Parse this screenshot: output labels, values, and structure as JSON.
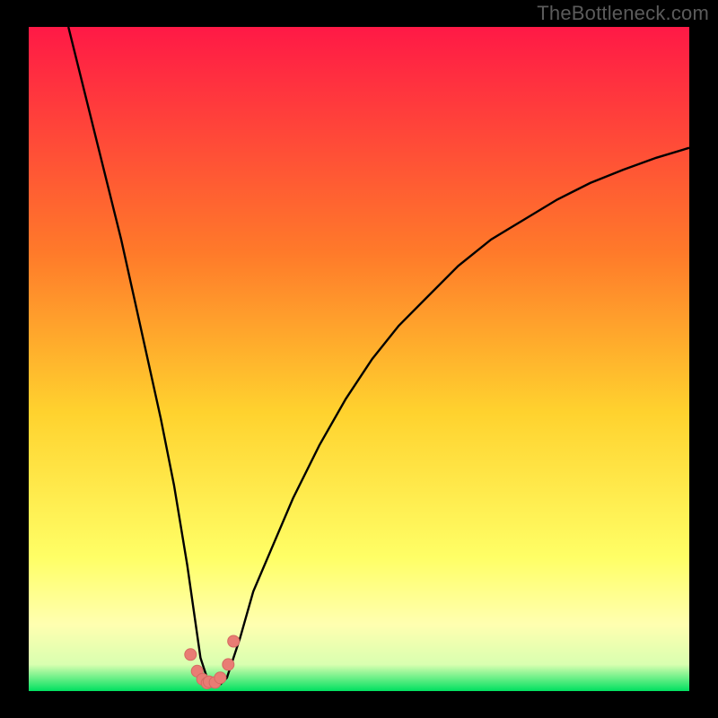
{
  "watermark": "TheBottleneck.com",
  "colors": {
    "background": "#000000",
    "gradient_top": "#ff1946",
    "gradient_mid_upper": "#ff7a2a",
    "gradient_mid": "#ffd22e",
    "gradient_lower": "#ffff66",
    "gradient_pale": "#ffffb0",
    "gradient_bottom": "#00e060",
    "curve": "#000000",
    "marker_fill": "#e97c74",
    "marker_stroke": "#d46a62"
  },
  "chart_data": {
    "type": "line",
    "title": "",
    "xlabel": "",
    "ylabel": "",
    "xlim": [
      0,
      100
    ],
    "ylim": [
      0,
      100
    ],
    "series": [
      {
        "name": "bottleneck-curve",
        "x": [
          6,
          8,
          10,
          12,
          14,
          16,
          18,
          20,
          22,
          24,
          25,
          26,
          27,
          28,
          29,
          30,
          32,
          34,
          37,
          40,
          44,
          48,
          52,
          56,
          60,
          65,
          70,
          75,
          80,
          85,
          90,
          95,
          100
        ],
        "y": [
          100,
          92,
          84,
          76,
          68,
          59,
          50,
          41,
          31,
          19,
          12,
          5,
          2,
          1,
          1,
          2,
          8,
          15,
          22,
          29,
          37,
          44,
          50,
          55,
          59,
          64,
          68,
          71,
          74,
          76.5,
          78.5,
          80.3,
          81.8
        ]
      }
    ],
    "markers": {
      "name": "highlight-points",
      "x": [
        24.5,
        25.5,
        26.3,
        27.0,
        27.3,
        28.2,
        29.0,
        30.2,
        31.0
      ],
      "y": [
        5.5,
        3.0,
        1.8,
        1.2,
        1.4,
        1.3,
        2.0,
        4.0,
        7.5
      ]
    }
  }
}
